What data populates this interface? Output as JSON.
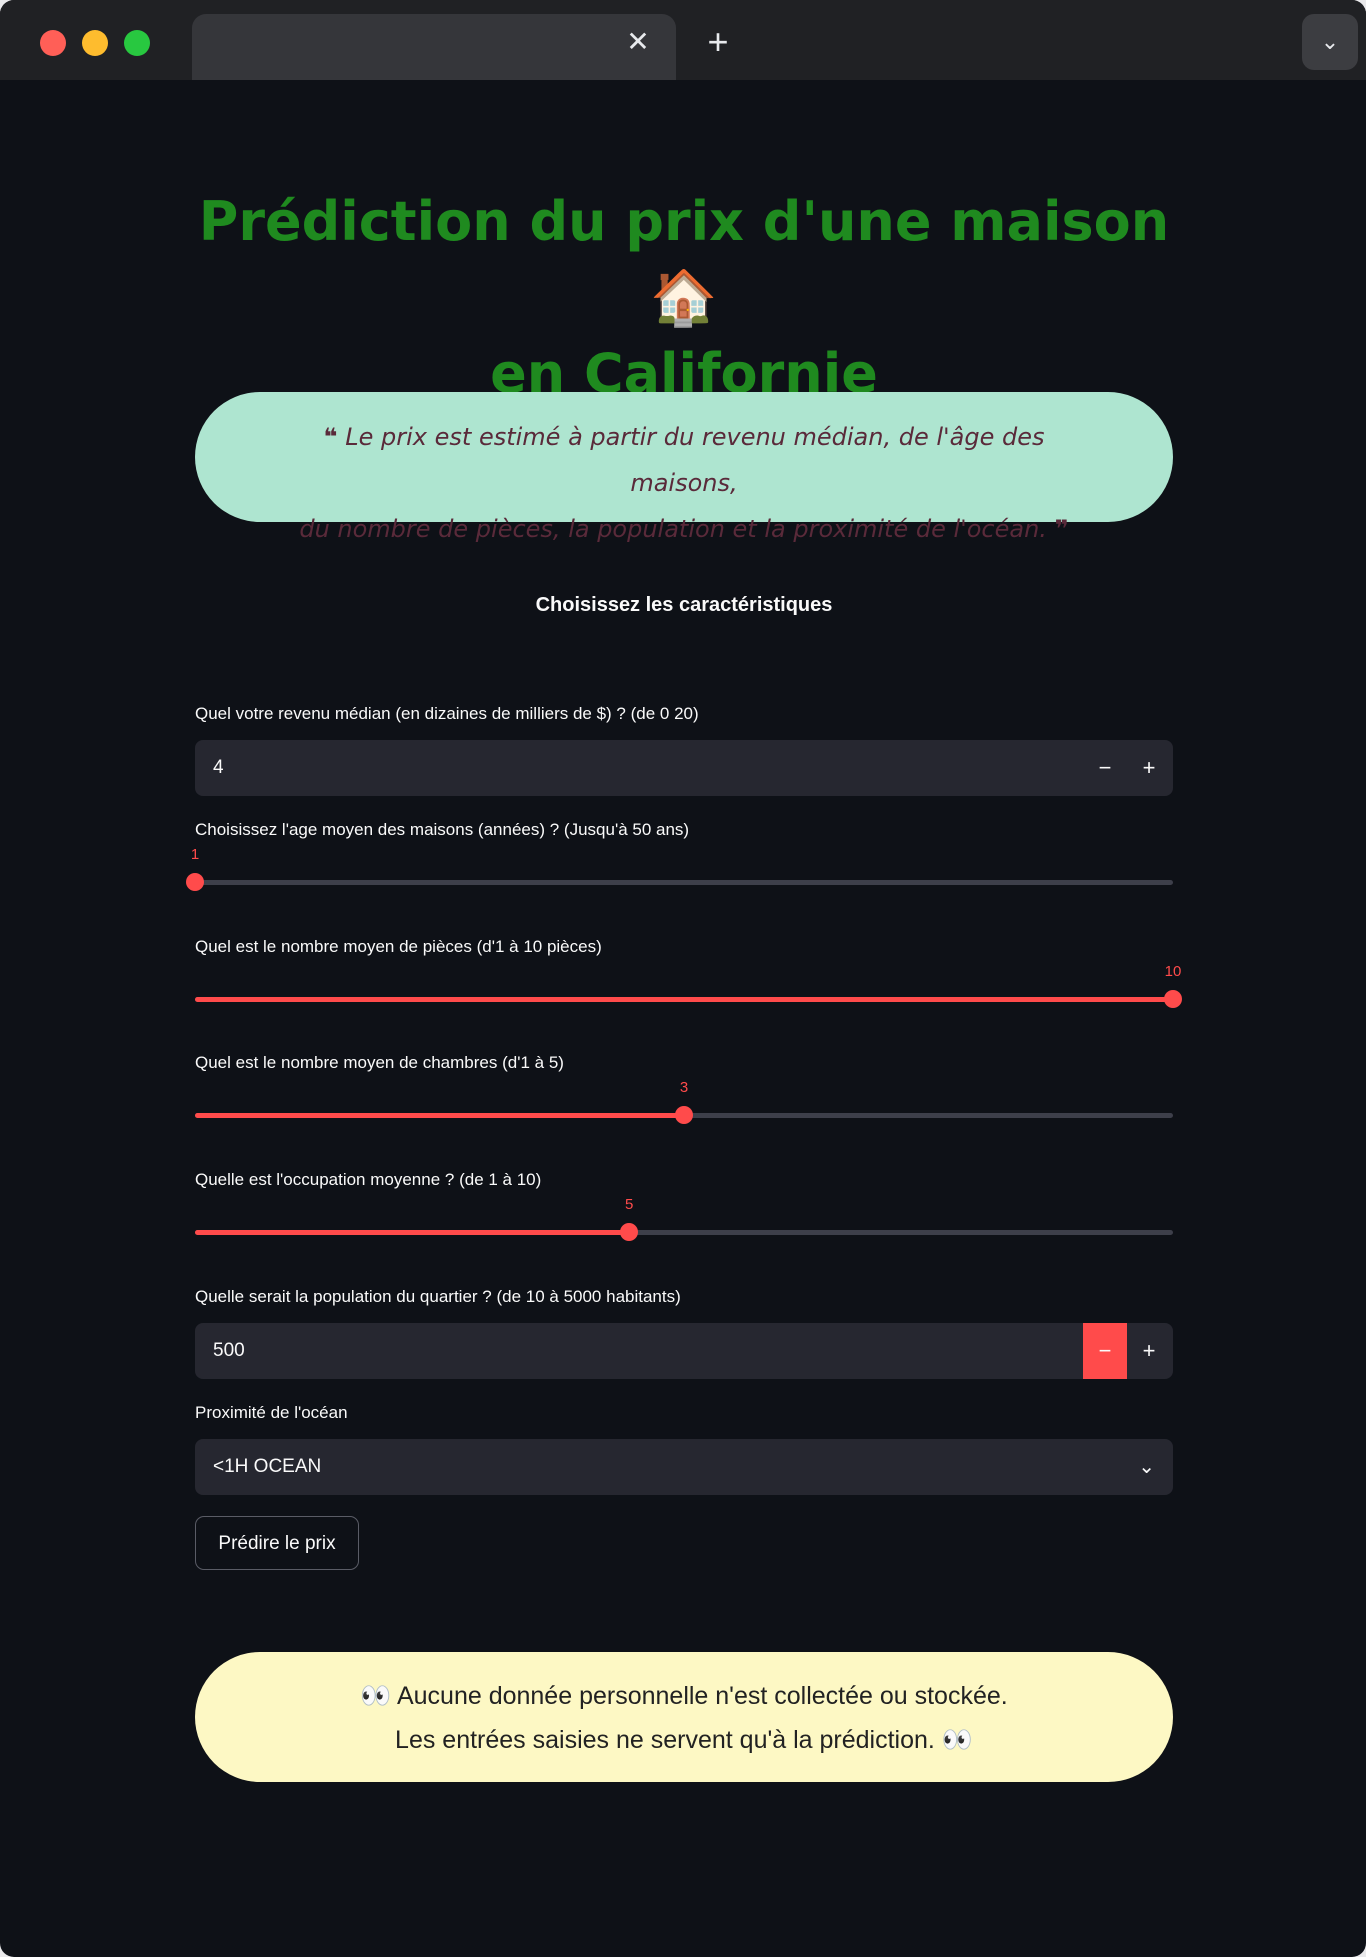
{
  "browser": {
    "tab_close": "✕",
    "new_tab": "+",
    "tab_menu": "⌄"
  },
  "page": {
    "title_line1": "Prédiction du prix d'une maison 🏠",
    "title_line2": "en Californie",
    "quote_line1": "Le prix est estimé à partir du revenu médian, de l'âge des maisons,",
    "quote_line2": "du nombre de pièces, la population et la proximité de l'océan.",
    "quote_open": "❝",
    "quote_close": "❞",
    "subheader": "Choisissez les caractéristiques"
  },
  "inputs": {
    "income": {
      "label": "Quel votre revenu médian (en dizaines de milliers de $) ? (de 0 20)",
      "value": "4",
      "minus": "−",
      "plus": "+"
    },
    "age": {
      "label": "Choisissez l'age moyen des maisons (années) ? (Jusqu'à 50 ans)",
      "value": "1",
      "fraction": 0.0
    },
    "rooms": {
      "label": "Quel est le nombre moyen de pièces (d'1 à 10 pièces)",
      "value": "10",
      "fraction": 1.0
    },
    "bedrooms": {
      "label": "Quel est le nombre moyen de chambres (d'1 à 5)",
      "value": "3",
      "fraction": 0.5
    },
    "occupancy": {
      "label": "Quelle est l'occupation moyenne ? (de 1 à 10)",
      "value": "5",
      "fraction": 0.444
    },
    "population": {
      "label": "Quelle serait la population du quartier ? (de 10 à 5000 habitants)",
      "value": "500",
      "minus": "−",
      "plus": "+"
    },
    "ocean": {
      "label": "Proximité de l'océan",
      "value": "<1H OCEAN",
      "chevron": "⌄"
    },
    "predict_button": "Prédire le prix"
  },
  "notice": {
    "line1": "👀 Aucune donnée personnelle n'est collectée ou stockée.",
    "line2": "Les entrées saisies ne servent qu'à la prédiction. 👀"
  },
  "colors": {
    "accent": "#ff4b4b",
    "title": "#1f8a1f",
    "quote_bg": "#aee5d0",
    "notice_bg": "#fdf8c4",
    "background": "#0e1117"
  }
}
